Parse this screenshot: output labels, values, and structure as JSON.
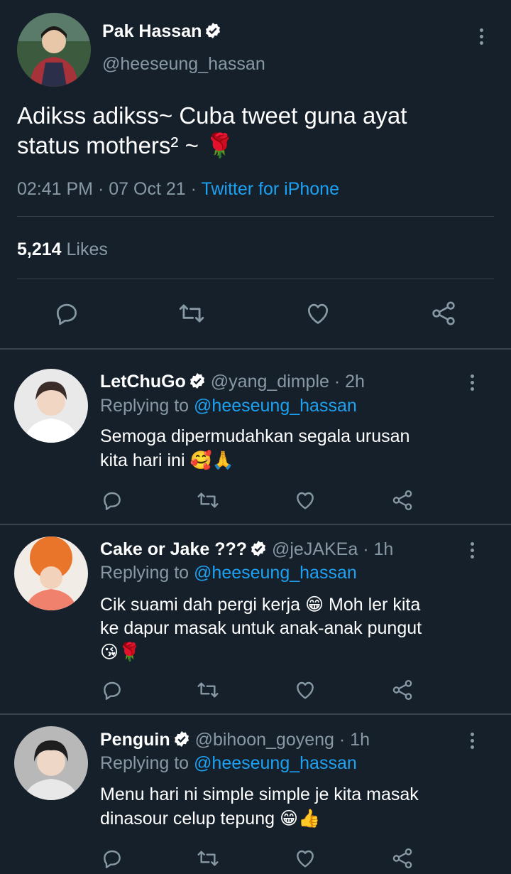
{
  "main_tweet": {
    "author_name": "Pak Hassan",
    "handle": "@heeseung_hassan",
    "text_line1": "Adikss adikss~ Cuba tweet guna ayat",
    "text_line2": "status mothers² ~",
    "text_emoji": "🌹",
    "time": "02:41 PM",
    "date": "07 Oct 21",
    "source": "Twitter for iPhone",
    "likes_count": "5,214",
    "likes_label": "Likes"
  },
  "separator": "·",
  "replying_label": "Replying to",
  "replies": [
    {
      "name": "LetChuGo",
      "handle": "@yang_dimple",
      "time": "2h",
      "replying_to": "@heeseung_hassan",
      "line1": "Semoga dipermudahkan segala urusan",
      "line2": "kita hari ini",
      "line2_emoji": "🥰🙏",
      "line3": "",
      "line3_emoji": ""
    },
    {
      "name": "Cake or Jake ???",
      "handle": "@jeJAKEa",
      "time": "1h",
      "replying_to": "@heeseung_hassan",
      "line1": "Cik suami dah pergi kerja 😁 Moh ler kita",
      "line2": "ke dapur masak untuk anak-anak pungut",
      "line2_emoji": "",
      "line3": "",
      "line3_emoji": "😘🌹"
    },
    {
      "name": "Penguin",
      "handle": "@bihoon_goyeng",
      "time": "1h",
      "replying_to": "@heeseung_hassan",
      "line1": "Menu hari ni simple simple je kita masak",
      "line2": "dinasour celup tepung",
      "line2_emoji": "😁👍",
      "line3": "",
      "line3_emoji": ""
    }
  ],
  "colors": {
    "background": "#15202b",
    "accent": "#1da1f2",
    "muted": "#8899a6",
    "divider": "#38444d"
  },
  "icons": [
    "verified-badge-icon",
    "more-options-icon",
    "reply-icon",
    "retweet-icon",
    "like-icon",
    "share-icon"
  ]
}
